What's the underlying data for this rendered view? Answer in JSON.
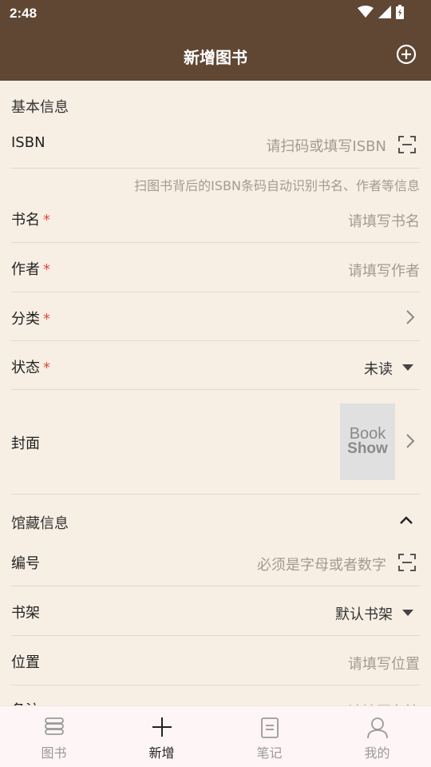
{
  "status": {
    "time": "2:48"
  },
  "header": {
    "title": "新增图书"
  },
  "sections": {
    "basic": "基本信息",
    "collection": "馆藏信息"
  },
  "fields": {
    "isbn": {
      "label": "ISBN",
      "placeholder": "请扫码或填写ISBN",
      "hint": "扫图书背后的ISBN条码自动识别书名、作者等信息"
    },
    "title": {
      "label": "书名",
      "required": "*",
      "placeholder": "请填写书名"
    },
    "author": {
      "label": "作者",
      "required": "*",
      "placeholder": "请填写作者"
    },
    "category": {
      "label": "分类",
      "required": "*"
    },
    "state": {
      "label": "状态",
      "required": "*",
      "value": "未读"
    },
    "cover": {
      "label": "封面",
      "image_line1": "Book",
      "image_line2": "Show"
    },
    "number": {
      "label": "编号",
      "placeholder": "必须是字母或者数字"
    },
    "shelf": {
      "label": "书架",
      "value": "默认书架"
    },
    "location": {
      "label": "位置",
      "placeholder": "请填写位置"
    },
    "remark": {
      "label": "备注",
      "placeholder": "请填写备注"
    }
  },
  "tabs": [
    {
      "label": "图书",
      "icon": "books-icon"
    },
    {
      "label": "新增",
      "icon": "plus-icon"
    },
    {
      "label": "笔记",
      "icon": "note-icon"
    },
    {
      "label": "我的",
      "icon": "person-icon"
    }
  ],
  "colors": {
    "header": "#5f4734",
    "background": "#f8efe4",
    "required": "#e04a3a",
    "tabbar": "#fdf5f6"
  }
}
